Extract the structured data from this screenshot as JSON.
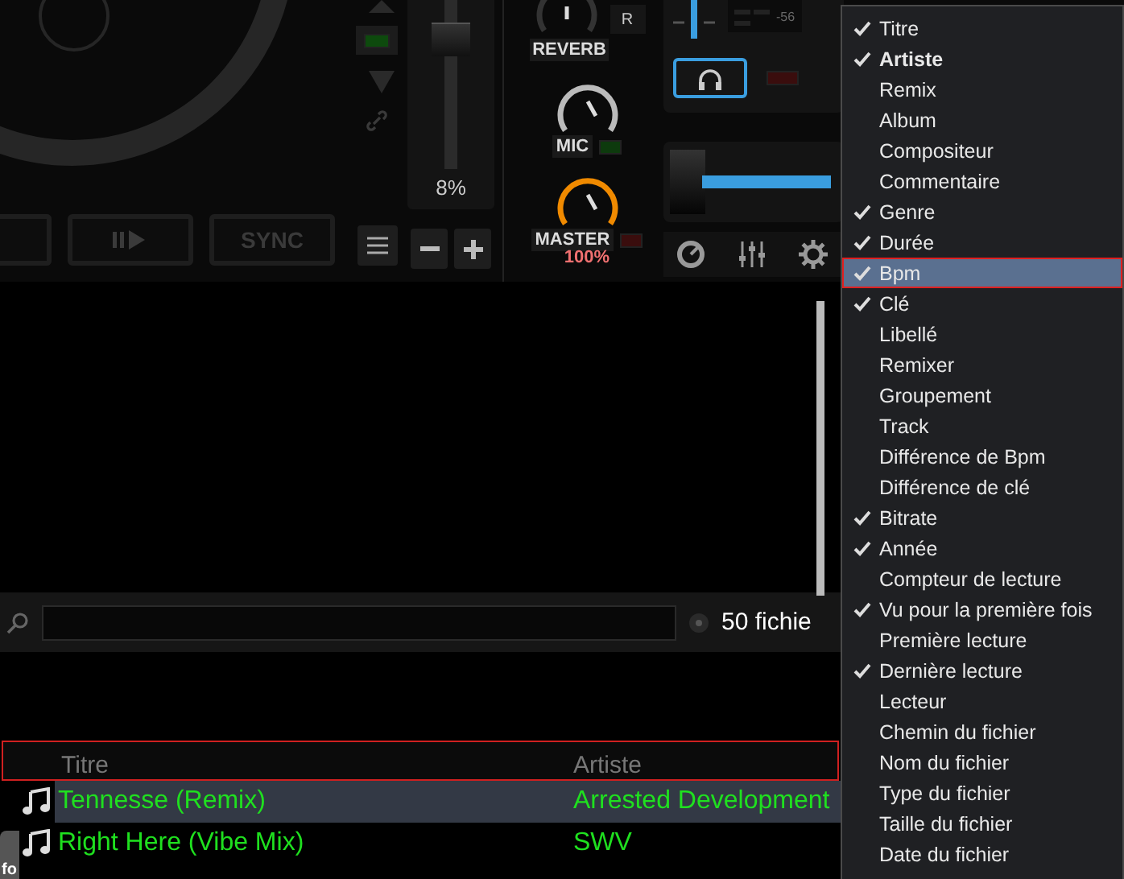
{
  "deck": {
    "sync_label": "SYNC",
    "pitch": "8%",
    "meter_reading": "-56"
  },
  "mixer": {
    "reverb_label": "REVERB",
    "reverb_button": "R",
    "mic_label": "MIC",
    "master_label": "MASTER",
    "master_reading": "100%",
    "headphone": {
      "on": true
    },
    "crossfader": {
      "level": 0.95
    }
  },
  "browser": {
    "file_count": "50 fichie",
    "side_tab": "fo",
    "columns": [
      "Titre",
      "Artiste"
    ],
    "rows": [
      {
        "title": "Tennesse (Remix)",
        "artist": "Arrested Development",
        "selected": true
      },
      {
        "title": "Right Here (Vibe Mix)",
        "artist": "SWV",
        "selected": false
      }
    ]
  },
  "column_menu": [
    {
      "label": "Titre",
      "checked": true,
      "bold": false,
      "selected": false
    },
    {
      "label": "Artiste",
      "checked": true,
      "bold": true,
      "selected": false
    },
    {
      "label": "Remix",
      "checked": false,
      "bold": false,
      "selected": false
    },
    {
      "label": "Album",
      "checked": false,
      "bold": false,
      "selected": false
    },
    {
      "label": "Compositeur",
      "checked": false,
      "bold": false,
      "selected": false
    },
    {
      "label": "Commentaire",
      "checked": false,
      "bold": false,
      "selected": false
    },
    {
      "label": "Genre",
      "checked": true,
      "bold": false,
      "selected": false
    },
    {
      "label": "Durée",
      "checked": true,
      "bold": false,
      "selected": false
    },
    {
      "label": "Bpm",
      "checked": true,
      "bold": false,
      "selected": true
    },
    {
      "label": "Clé",
      "checked": true,
      "bold": false,
      "selected": false
    },
    {
      "label": "Libellé",
      "checked": false,
      "bold": false,
      "selected": false
    },
    {
      "label": "Remixer",
      "checked": false,
      "bold": false,
      "selected": false
    },
    {
      "label": "Groupement",
      "checked": false,
      "bold": false,
      "selected": false
    },
    {
      "label": "Track",
      "checked": false,
      "bold": false,
      "selected": false
    },
    {
      "label": "Différence de Bpm",
      "checked": false,
      "bold": false,
      "selected": false
    },
    {
      "label": "Différence de clé",
      "checked": false,
      "bold": false,
      "selected": false
    },
    {
      "label": "Bitrate",
      "checked": true,
      "bold": false,
      "selected": false
    },
    {
      "label": "Année",
      "checked": true,
      "bold": false,
      "selected": false
    },
    {
      "label": "Compteur de lecture",
      "checked": false,
      "bold": false,
      "selected": false
    },
    {
      "label": "Vu pour la première fois",
      "checked": true,
      "bold": false,
      "selected": false
    },
    {
      "label": "Première lecture",
      "checked": false,
      "bold": false,
      "selected": false
    },
    {
      "label": "Dernière lecture",
      "checked": true,
      "bold": false,
      "selected": false
    },
    {
      "label": "Lecteur",
      "checked": false,
      "bold": false,
      "selected": false
    },
    {
      "label": "Chemin du fichier",
      "checked": false,
      "bold": false,
      "selected": false
    },
    {
      "label": "Nom du fichier",
      "checked": false,
      "bold": false,
      "selected": false
    },
    {
      "label": "Type du fichier",
      "checked": false,
      "bold": false,
      "selected": false
    },
    {
      "label": "Taille du fichier",
      "checked": false,
      "bold": false,
      "selected": false
    },
    {
      "label": "Date du fichier",
      "checked": false,
      "bold": false,
      "selected": false
    }
  ]
}
